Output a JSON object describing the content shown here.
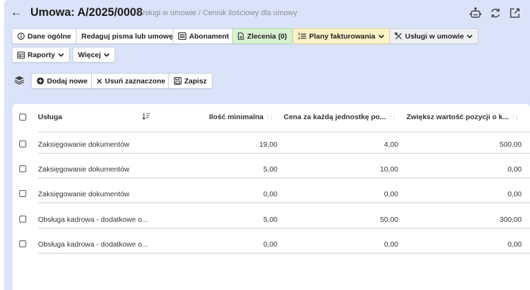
{
  "header": {
    "title": "Umowa: A/2025/0008",
    "subtitle": "Usługi w umowie / Cennik ilościowy dla umowy"
  },
  "toolbar": {
    "dane_ogolne": "Dane ogólne",
    "redaguj": "Redaguj pisma lub umowę",
    "abonament": "Abonament",
    "zlecenia": "Zlecenia (0)",
    "plany": "Plany fakturowania",
    "uslugi": "Usługi w umowie",
    "raporty": "Raporty",
    "wiecej": "Więcej"
  },
  "actions": {
    "dodaj": "Dodaj nowe",
    "usun": "Usuń zaznaczone",
    "zapisz": "Zapisz"
  },
  "table": {
    "columns": {
      "usluga": "Usługa",
      "ilosc": "Ilość minimalna",
      "cena": "Cena za każdą jednostkę po...",
      "zwieksz": "Zwiększ wartość pozycji o k..."
    },
    "rows": [
      {
        "usluga": "Zaksięgowanie dokumentów",
        "ilosc": "19,00",
        "cena": "4,00",
        "zwieksz": "500,00"
      },
      {
        "usluga": "Zaksięgowanie dokumentów",
        "ilosc": "5,00",
        "cena": "10,00",
        "zwieksz": "0,00"
      },
      {
        "usluga": "Zaksięgowanie dokumentów",
        "ilosc": "0,00",
        "cena": "0,00",
        "zwieksz": "0,00"
      },
      {
        "usluga": "Obsługa kadrowa - dodatkowe o...",
        "ilosc": "5,00",
        "cena": "50,00",
        "zwieksz": "300,00"
      },
      {
        "usluga": "Obsługa kadrowa - dodatkowe o...",
        "ilosc": "0,00",
        "cena": "0,00",
        "zwieksz": "0,00"
      }
    ]
  },
  "icons": {
    "back": "arrow-left-icon",
    "robot": "robot-icon",
    "refresh": "refresh-icon",
    "external": "external-link-icon"
  }
}
